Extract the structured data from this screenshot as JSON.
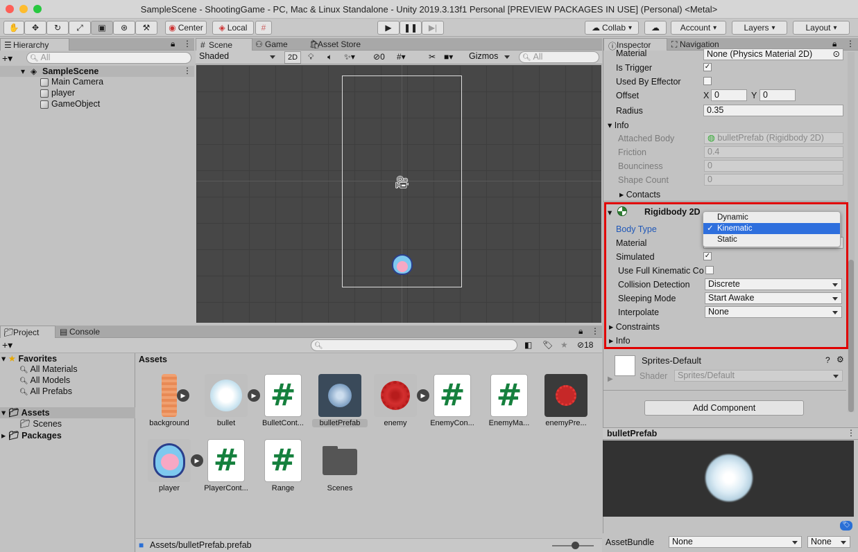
{
  "window": {
    "title": "SampleScene - ShootingGame - PC, Mac & Linux Standalone - Unity 2019.3.13f1 Personal [PREVIEW PACKAGES IN USE] (Personal) <Metal>"
  },
  "toolbar": {
    "center": "Center",
    "local": "Local",
    "collab": "Collab",
    "account": "Account",
    "layers": "Layers",
    "layout": "Layout"
  },
  "hierarchy": {
    "tab": "Hierarchy",
    "search_placeholder": "All",
    "scene": "SampleScene",
    "items": [
      "Main Camera",
      "player",
      "GameObject"
    ]
  },
  "scene_view": {
    "tabs": [
      "Scene",
      "Game",
      "Asset Store"
    ],
    "shading": "Shaded",
    "mode2d": "2D",
    "hidden_count": "0",
    "gizmos": "Gizmos",
    "search_placeholder": "All"
  },
  "project": {
    "tabs": [
      "Project",
      "Console"
    ],
    "hidden_count": "18",
    "favorites": "Favorites",
    "favorite_items": [
      "All Materials",
      "All Models",
      "All Prefabs"
    ],
    "assets": "Assets",
    "asset_children": [
      "Scenes"
    ],
    "packages": "Packages",
    "breadcrumb": "Assets",
    "path": "Assets/bulletPrefab.prefab",
    "items": [
      {
        "name": "background",
        "icon": "background-sprite"
      },
      {
        "name": "bullet",
        "icon": "bullet-sprite"
      },
      {
        "name": "BulletCont...",
        "icon": "script-hash"
      },
      {
        "name": "bulletPrefab",
        "icon": "prefab"
      },
      {
        "name": "enemy",
        "icon": "enemy-sprite"
      },
      {
        "name": "EnemyCon...",
        "icon": "script-hash"
      },
      {
        "name": "EnemyMa...",
        "icon": "script-hash"
      },
      {
        "name": "enemyPre...",
        "icon": "prefab"
      },
      {
        "name": "player",
        "icon": "player-sprite"
      },
      {
        "name": "PlayerCont...",
        "icon": "script-hash"
      },
      {
        "name": "Range",
        "icon": "script-hash"
      },
      {
        "name": "Scenes",
        "icon": "folder"
      }
    ]
  },
  "inspector": {
    "tabs": [
      "Inspector",
      "Navigation"
    ],
    "collider": {
      "material_label": "Material",
      "material_value": "None (Physics Material 2D)",
      "is_trigger": "Is Trigger",
      "used_by_effector": "Used By Effector",
      "offset": "Offset",
      "offset_x": "0",
      "offset_y": "0",
      "radius": "Radius",
      "radius_value": "0.35",
      "info": "Info",
      "attached_body": "Attached Body",
      "attached_body_value": "bulletPrefab (Rigidbody 2D)",
      "friction": "Friction",
      "friction_value": "0.4",
      "bounciness": "Bounciness",
      "bounciness_value": "0",
      "shape_count": "Shape Count",
      "shape_count_value": "0",
      "contacts": "Contacts"
    },
    "rigidbody": {
      "title": "Rigidbody 2D",
      "body_type": "Body Type",
      "body_type_options": [
        "Dynamic",
        "Kinematic",
        "Static"
      ],
      "selected": "Kinematic",
      "material": "Material",
      "simulated": "Simulated",
      "use_full_kinematic": "Use Full Kinematic Co",
      "collision_detection": "Collision Detection",
      "collision_value": "Discrete",
      "sleeping_mode": "Sleeping Mode",
      "sleeping_value": "Start Awake",
      "interpolate": "Interpolate",
      "interpolate_value": "None",
      "constraints": "Constraints",
      "info": "Info"
    },
    "material_section": {
      "name": "Sprites-Default",
      "shader_label": "Shader",
      "shader_value": "Sprites/Default"
    },
    "add_component": "Add Component",
    "preview_title": "bulletPrefab",
    "assetbundle": "AssetBundle",
    "assetbundle_value": "None",
    "variant_value": "None"
  },
  "colors": {
    "highlight_box": "#e00000",
    "selection": "#2e6fdd",
    "scene_bg": "#474747"
  }
}
